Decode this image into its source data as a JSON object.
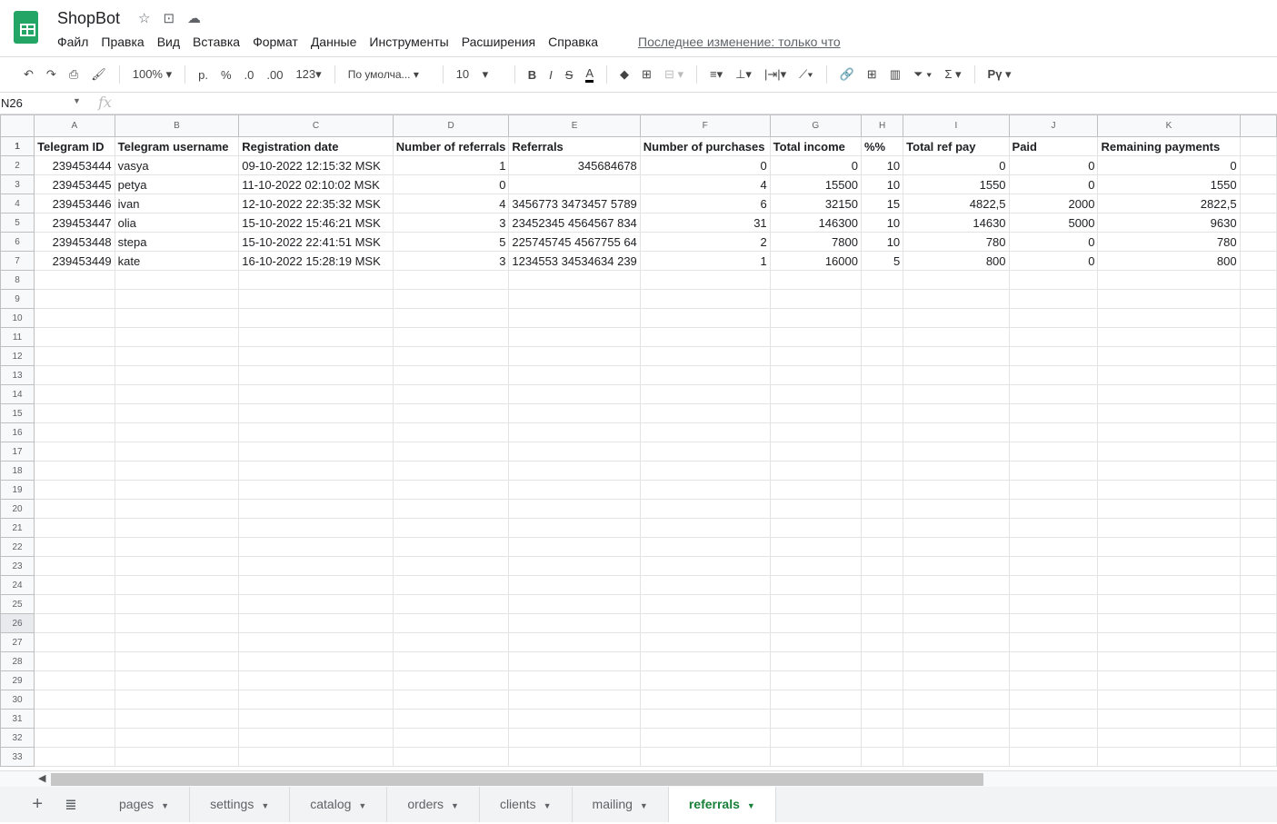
{
  "app": {
    "title": "ShopBot",
    "menu": [
      "Файл",
      "Правка",
      "Вид",
      "Вставка",
      "Формат",
      "Данные",
      "Инструменты",
      "Расширения",
      "Справка"
    ],
    "last_edit": "Последнее изменение: только что"
  },
  "toolbar": {
    "zoom": "100%",
    "currency": "р.",
    "percent": "%",
    "dec_dec": ".0",
    "dec_inc": ".00",
    "format": "123",
    "font": "По умолча...",
    "size": "10",
    "bold": "B",
    "italic": "I",
    "strike": "S",
    "text_color": "A",
    "script": "Рү"
  },
  "formula_bar": {
    "cell": "N26",
    "fx": "fx",
    "value": ""
  },
  "columns": [
    "A",
    "B",
    "C",
    "D",
    "E",
    "F",
    "G",
    "H",
    "I",
    "J",
    "K",
    ""
  ],
  "headers": [
    "Telegram ID",
    "Telegram username",
    "Registration date",
    "Number of referrals",
    "Referrals",
    "Number of purchases",
    "Total income",
    "%%",
    "Total ref pay",
    "Paid",
    "Remaining payments",
    ""
  ],
  "rows": [
    [
      "239453444",
      "vasya",
      "09-10-2022 12:15:32 MSK",
      "1",
      "345684678",
      "0",
      "0",
      "10",
      "0",
      "0",
      "0"
    ],
    [
      "239453445",
      "petya",
      "11-10-2022 02:10:02 MSK",
      "0",
      "",
      "4",
      "15500",
      "10",
      "1550",
      "0",
      "1550"
    ],
    [
      "239453446",
      "ivan",
      "12-10-2022 22:35:32 MSK",
      "4",
      "3456773 3473457 5789",
      "6",
      "32150",
      "15",
      "4822,5",
      "2000",
      "2822,5"
    ],
    [
      "239453447",
      "olia",
      "15-10-2022 15:46:21 MSK",
      "3",
      "23452345 4564567 834",
      "31",
      "146300",
      "10",
      "14630",
      "5000",
      "9630"
    ],
    [
      "239453448",
      "stepa",
      "15-10-2022 22:41:51 MSK",
      "5",
      "225745745 4567755 64",
      "2",
      "7800",
      "10",
      "780",
      "0",
      "780"
    ],
    [
      "239453449",
      "kate",
      "16-10-2022 15:28:19 MSK",
      "3",
      "1234553 34534634  239",
      "1",
      "16000",
      "5",
      "800",
      "0",
      "800"
    ]
  ],
  "row_count": 33,
  "selected_row": 26,
  "sheets": [
    {
      "name": "pages"
    },
    {
      "name": "settings"
    },
    {
      "name": "catalog"
    },
    {
      "name": "orders"
    },
    {
      "name": "clients"
    },
    {
      "name": "mailing"
    },
    {
      "name": "referrals",
      "active": true
    }
  ]
}
